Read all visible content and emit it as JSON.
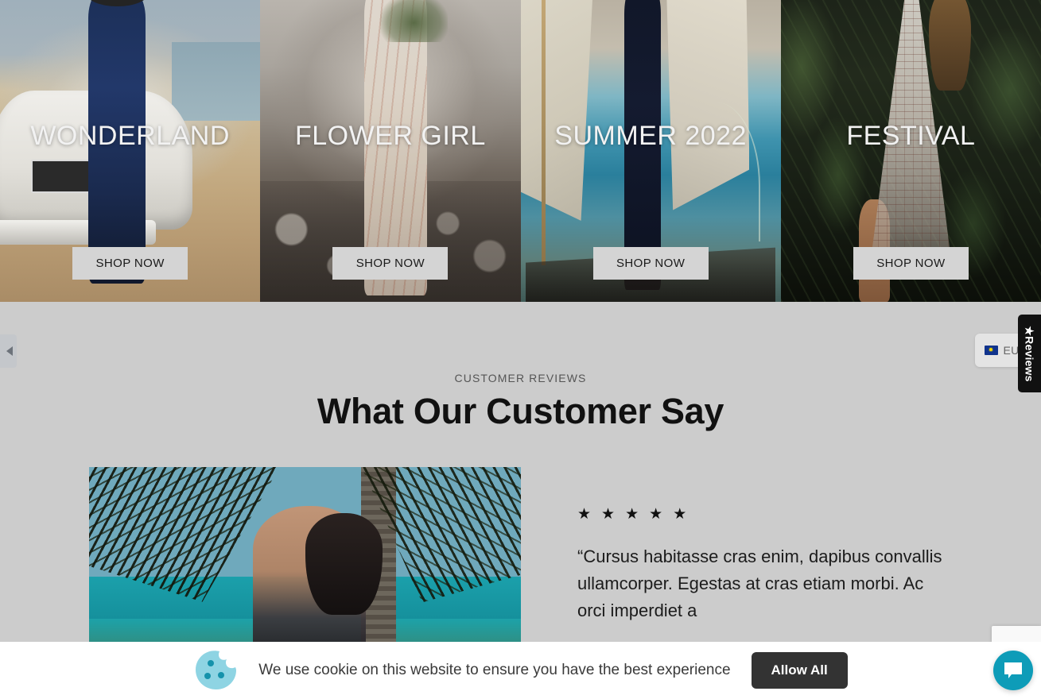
{
  "banners": [
    {
      "title": "WONDERLAND",
      "cta": "SHOP NOW",
      "bg_class": "bg-wonderland"
    },
    {
      "title": "FLOWER GIRL",
      "cta": "SHOP NOW",
      "bg_class": "bg-flower"
    },
    {
      "title": "SUMMER 2022",
      "cta": "SHOP NOW",
      "bg_class": "bg-summer"
    },
    {
      "title": "FESTIVAL",
      "cta": "SHOP NOW",
      "bg_class": "bg-festival"
    }
  ],
  "carousel": {
    "prev_icon": "chevron-left-icon"
  },
  "currency": {
    "code": "EUR",
    "flag": "eu-flag-icon"
  },
  "reviews_tab": {
    "label": "★Reviews"
  },
  "testimonials": {
    "eyebrow": "CUSTOMER REVIEWS",
    "title": "What Our Customer Say",
    "stars": "★ ★ ★ ★ ★",
    "star_count": 5,
    "quote": "“Cursus habitasse cras enim, dapibus convallis ullamcorper. Egestas at cras etiam morbi. Ac orci imperdiet a"
  },
  "cookie": {
    "icon": "cookie-icon",
    "message": "We use cookie on this website to ensure you have the best experience",
    "accept_label": "Allow All"
  },
  "chat": {
    "icon": "chat-bubble-icon"
  },
  "colors": {
    "page_bg": "#cccccc",
    "banner_cta_bg": "#d4d4d4",
    "reviews_tab_bg": "#111111",
    "cookie_bar_bg": "#ffffff",
    "allow_button_bg": "#333333",
    "chat_accent": "#0e9cb8",
    "cookie_icon": "#8ed4e3"
  }
}
